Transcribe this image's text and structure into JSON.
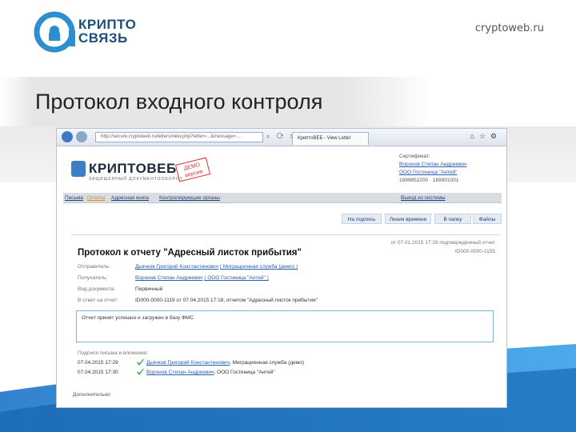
{
  "slide": {
    "logo_line1": "КРИПТО",
    "logo_line2": "СВЯЗЬ",
    "site": "cryptoweb.ru",
    "title": "Протокол входного контроля"
  },
  "colors": {
    "brand_blue": "#1a5fa8",
    "logo_teal": "#2c8fd0",
    "link": "#2a5db0",
    "active_nav": "#e08a00"
  },
  "browser": {
    "address": "http://secure.cryptoweb.ru/letters/view.php?letter=...&message=...",
    "tab_label": "КриптоВЕБ - View Letter"
  },
  "app": {
    "logo": "КРИПТОВЕБ",
    "logo_sub": "ЗАЩИЩЕННЫЙ ДОКУМЕНТООБОРОТ",
    "demo_stamp": "ДЕМО версия",
    "cert": {
      "label": "Сертификат:",
      "name": "Воронов Степан Андреевич",
      "org": "ООО Гостиница \"Антей\"",
      "ids": "1899852200 · 189901001"
    }
  },
  "nav": {
    "items": [
      "Письма",
      "Отчеты",
      "Адресная книга",
      "Контролирующие органы"
    ],
    "active_index": 1,
    "logout": "Выход из системы"
  },
  "actions": [
    "На подпись",
    "Линия времени",
    "В папку",
    "Файлы"
  ],
  "protocol": {
    "title": "Протокол к отчету \"Адресный листок прибытия\"",
    "date_line": "от 07.01.2015 17:29 подтвержденный отчет",
    "number": "ID000-0000-1155",
    "rows": [
      {
        "label": "Отправитель:",
        "value": "Дьячков Григорий Константинович",
        "extra": "( Миграционная служба (демо) )"
      },
      {
        "label": "Получатель:",
        "value": "Воронов Степан Андреевич",
        "extra": "( ООО Гостиница \"Антей\" )"
      },
      {
        "label": "Вид документа:",
        "value": "Первичный",
        "extra": ""
      },
      {
        "label": "В ответ на отчет:",
        "value": "ID000-0000-1119 от 07.04.2015 17:18, отчетом \"Адресный листок прибытия\"",
        "extra": ""
      }
    ],
    "note": "Отчет принят успешно и загружен в базу ФМС",
    "signers_title": "Подписи письма и вложения:",
    "signers": [
      {
        "time": "07.04.2015 17:29",
        "name": "Дьячков Григорий Константинович",
        "org": ", Миграционная служба (демо)"
      },
      {
        "time": "07.04.2015 17:30",
        "name": "Воронов Степан Андреевич",
        "org": ", ООО Гостиница \"Антей\""
      }
    ],
    "extra": "Дополнительно"
  }
}
